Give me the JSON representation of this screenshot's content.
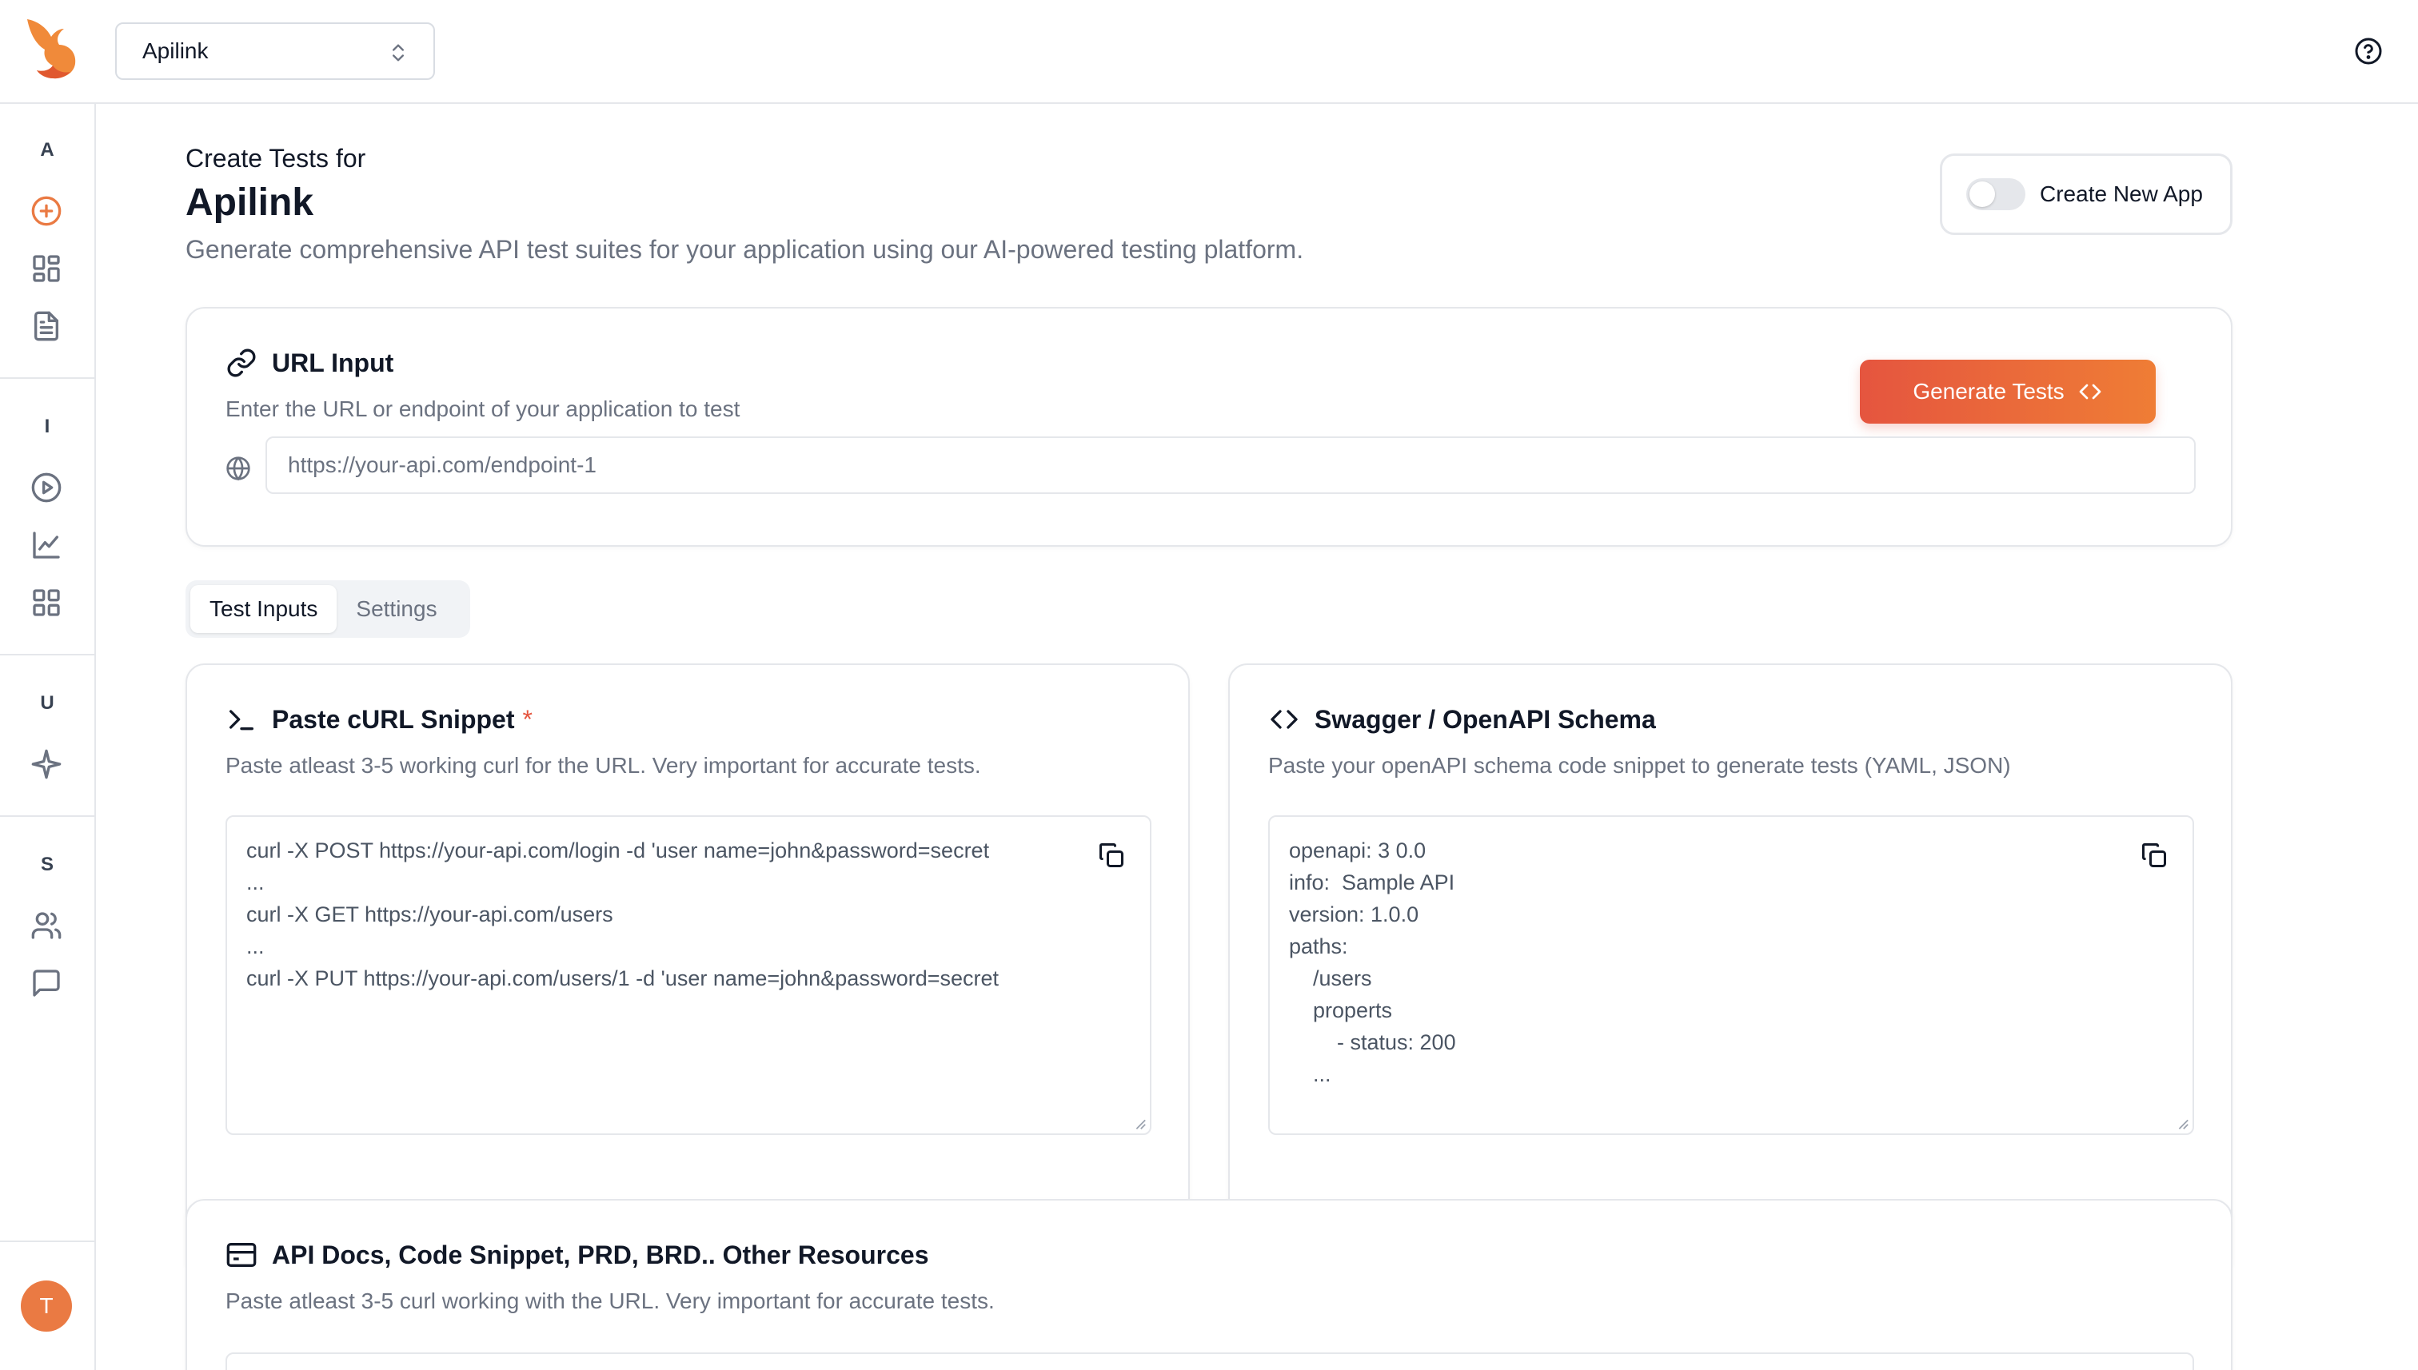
{
  "header": {
    "app_selector": {
      "value": "Apilink"
    }
  },
  "sidebar": {
    "sections": [
      {
        "letter": "A",
        "items": [
          "add-circle-icon",
          "dashboard-icon",
          "document-icon"
        ]
      },
      {
        "letter": "I",
        "items": [
          "play-circle-icon",
          "line-chart-icon",
          "grid-icon"
        ]
      },
      {
        "letter": "U",
        "items": [
          "sparkle-icon"
        ]
      },
      {
        "letter": "S",
        "items": [
          "users-icon",
          "chat-icon"
        ]
      }
    ],
    "avatar_initial": "T",
    "accent": "#ea7a43"
  },
  "page": {
    "kicker": "Create Tests for",
    "title": "Apilink",
    "subtitle": "Generate comprehensive API test suites for your application using our AI-powered testing platform.",
    "create_new_app_label": "Create New App",
    "create_new_app_enabled": false
  },
  "url_card": {
    "title": "URL Input",
    "description": "Enter the URL or endpoint of your application to test",
    "generate_label": "Generate Tests",
    "url_placeholder": "https://your-api.com/endpoint-1"
  },
  "tabs": [
    {
      "label": "Test Inputs",
      "active": true
    },
    {
      "label": "Settings",
      "active": false
    }
  ],
  "curl_card": {
    "title": "Paste cURL Snippet",
    "required_mark": "*",
    "description": "Paste atleast 3-5 working curl for the URL. Very important for accurate tests.",
    "lines": [
      "curl -X POST https://your-api.com/login -d 'user name=john&password=secret",
      "...",
      "curl -X GET https://your-api.com/users",
      "...",
      "curl -X PUT https://your-api.com/users/1 -d 'user name=john&password=secret"
    ]
  },
  "swagger_card": {
    "title": "Swagger / OpenAPI Schema",
    "description": "Paste your openAPI schema code snippet to generate tests (YAML, JSON)",
    "lines": [
      "openapi: 3 0.0",
      "info:  Sample API",
      "version: 1.0.0",
      "paths:",
      "    /users",
      "    properts",
      "        - status: 200",
      "    ..."
    ]
  },
  "docs_card": {
    "title": "API Docs, Code Snippet, PRD, BRD.. Other Resources",
    "description": "Paste atleast 3-5 curl working with the URL. Very important for accurate tests."
  },
  "colors": {
    "primary_gradient_start": "#e5553f",
    "primary_gradient_end": "#ef7d35",
    "muted_text": "#6b7280",
    "border": "#e5e7eb"
  }
}
